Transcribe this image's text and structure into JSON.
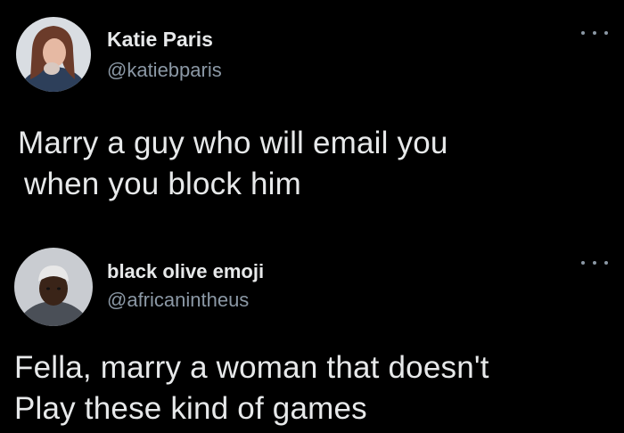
{
  "tweets": [
    {
      "display_name": "Katie Paris",
      "handle": "@katiebparis",
      "text_lines": [
        "Marry a guy who will email you",
        "when you block him"
      ],
      "avatar_icon": "profile-photo"
    },
    {
      "display_name": "black olive emoji",
      "handle": "@africanintheus",
      "text_lines": [
        "Fella, marry a woman that doesn't",
        "Play these kind of games"
      ],
      "avatar_icon": "profile-photo"
    }
  ],
  "more_icon": "more-horizontal-icon",
  "colors": {
    "background": "#000000",
    "text_primary": "#e7e9ea",
    "text_secondary": "#8b98a5"
  }
}
